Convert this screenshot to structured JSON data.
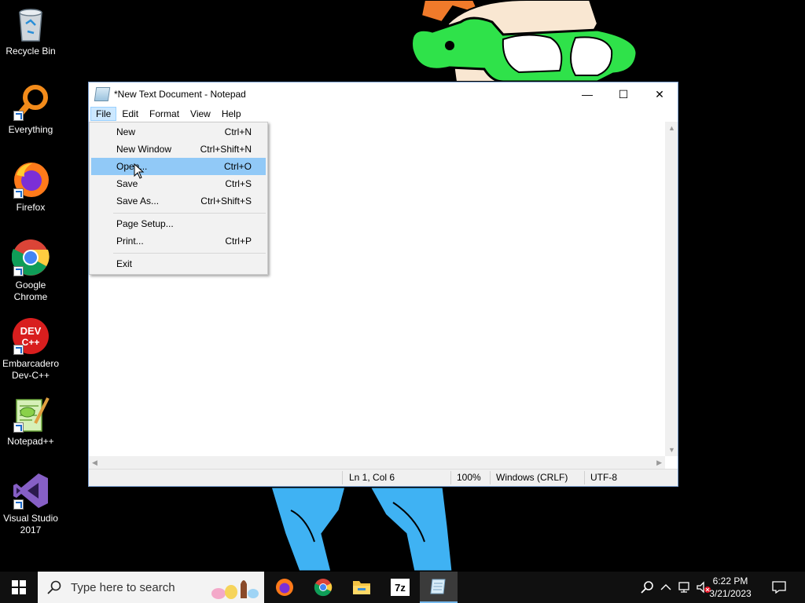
{
  "desktop": {
    "icons": [
      {
        "label": "Recycle Bin",
        "icon": "recycle-bin-icon"
      },
      {
        "label": "Everything",
        "icon": "everything-search-icon"
      },
      {
        "label": "Firefox",
        "icon": "firefox-icon"
      },
      {
        "label": "Google Chrome",
        "icon": "chrome-icon"
      },
      {
        "label": "Embarcadero Dev-C++",
        "icon": "devcpp-icon"
      },
      {
        "label": "Notepad++",
        "icon": "notepadpp-icon"
      },
      {
        "label": "Visual Studio 2017",
        "icon": "visual-studio-icon"
      }
    ],
    "devcpp_badge": "DEV\nC++"
  },
  "notepad": {
    "title": "*New Text Document - Notepad",
    "minimize": "—",
    "maximize": "☐",
    "close": "✕",
    "menu": [
      "File",
      "Edit",
      "Format",
      "View",
      "Help"
    ],
    "status": {
      "position": "Ln 1, Col 6",
      "zoom": "100%",
      "line_endings": "Windows (CRLF)",
      "encoding": "UTF-8"
    }
  },
  "file_menu": {
    "items": [
      {
        "label": "New",
        "shortcut": "Ctrl+N"
      },
      {
        "label": "New Window",
        "shortcut": "Ctrl+Shift+N"
      },
      {
        "label": "Open...",
        "shortcut": "Ctrl+O"
      },
      {
        "label": "Save",
        "shortcut": "Ctrl+S"
      },
      {
        "label": "Save As...",
        "shortcut": "Ctrl+Shift+S"
      },
      {
        "label": "Page Setup...",
        "shortcut": ""
      },
      {
        "label": "Print...",
        "shortcut": "Ctrl+P"
      },
      {
        "label": "Exit",
        "shortcut": ""
      }
    ],
    "highlighted": "Open..."
  },
  "taskbar": {
    "search_placeholder": "Type here to search",
    "apps": [
      "firefox-icon",
      "chrome-icon",
      "file-explorer-icon",
      "7zip-icon",
      "notepad-icon"
    ],
    "sevenzip_label": "7z",
    "time": "6:22 PM",
    "date": "3/21/2023"
  },
  "colors": {
    "highlight": "#91c9f7",
    "menu_active": "#cce8ff",
    "taskbar": "#101010"
  }
}
